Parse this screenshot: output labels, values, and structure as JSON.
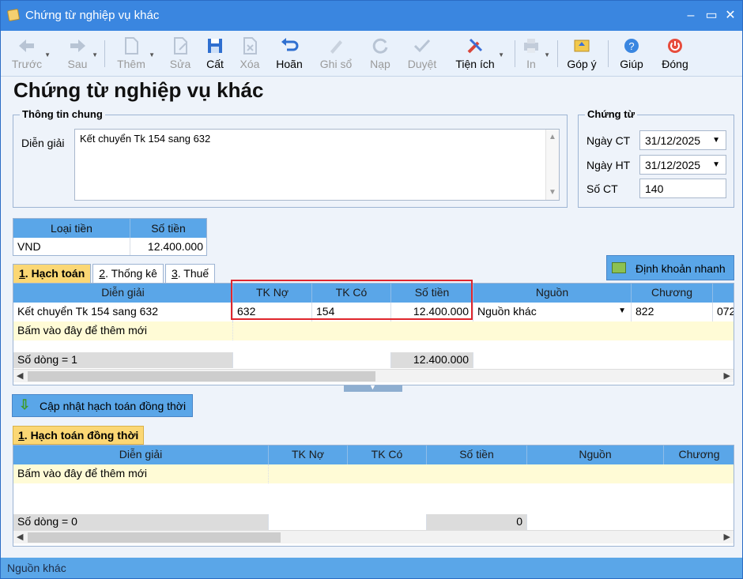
{
  "window": {
    "title": "Chứng từ nghiệp vụ khác",
    "minimize": "–",
    "maximize": "▭",
    "close": "✕"
  },
  "toolbar": {
    "back": "Trước",
    "next": "Sau",
    "add": "Thêm",
    "edit": "Sửa",
    "save": "Cất",
    "delete": "Xóa",
    "undo": "Hoãn",
    "post": "Ghi sổ",
    "reload": "Nạp",
    "approve": "Duyệt",
    "utilities": "Tiện ích",
    "print": "In",
    "feedback": "Góp ý",
    "help": "Giúp",
    "close": "Đóng"
  },
  "page_title": "Chứng từ nghiệp vụ khác",
  "general_info": {
    "legend": "Thông tin chung",
    "description_label": "Diễn giải",
    "description_value": "Kết chuyển Tk 154 sang 632"
  },
  "voucher": {
    "legend": "Chứng từ",
    "date_ct_label": "Ngày CT",
    "date_ct": "31/12/2025",
    "date_ht_label": "Ngày HT",
    "date_ht": "31/12/2025",
    "number_label": "Số CT",
    "number": "140"
  },
  "currency_table": {
    "headers": [
      "Loại tiền",
      "Số tiền"
    ],
    "row": [
      "VND",
      "12.400.000"
    ]
  },
  "tabs": [
    {
      "num": "1",
      "label": ". Hạch toán"
    },
    {
      "num": "2",
      "label": ". Thống kê"
    },
    {
      "num": "3",
      "label": ". Thuế"
    }
  ],
  "quick_entry_button": "Định khoản nhanh",
  "main_grid": {
    "headers": [
      "Diễn giải",
      "TK Nợ",
      "TK Có",
      "Số tiền",
      "Nguồn",
      "Chương",
      ""
    ],
    "rows": [
      [
        "Kết chuyển Tk 154 sang 632",
        "632",
        "154",
        "12.400.000",
        "Nguồn khác",
        "822",
        "072"
      ]
    ],
    "add_new": "Bấm vào đây để thêm mới",
    "footer_count": "Số dòng = 1",
    "footer_total": "12.400.000"
  },
  "update_button": "Cập nhật hạch toán đồng thời",
  "second_tab": {
    "num": "1",
    "label": ". Hạch toán đồng thời"
  },
  "second_grid": {
    "headers": [
      "Diễn giải",
      "TK Nợ",
      "TK Có",
      "Số tiền",
      "Nguồn",
      "Chương"
    ],
    "add_new": "Bấm vào đây để thêm mới",
    "footer_count": "Số dòng = 0",
    "footer_total": "0"
  },
  "status_bar": "Nguồn khác"
}
